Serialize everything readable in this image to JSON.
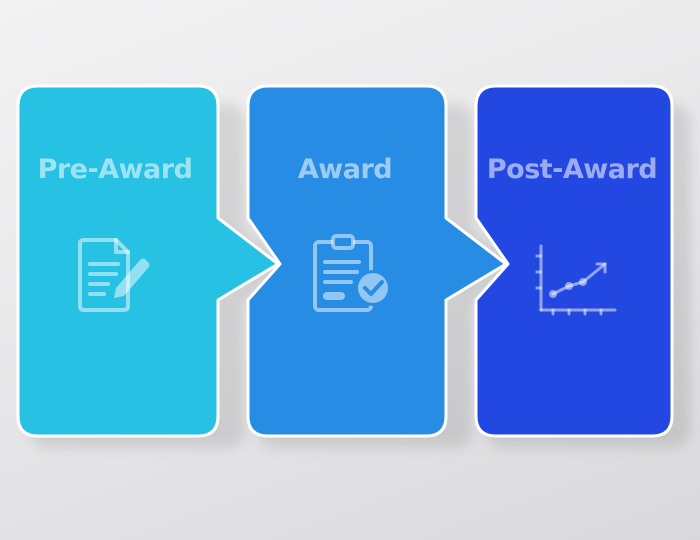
{
  "stages": [
    {
      "label": "Pre-Award",
      "color": "#27c1e4",
      "icon": "document-edit-icon"
    },
    {
      "label": "Award",
      "color": "#278de4",
      "icon": "clipboard-check-icon"
    },
    {
      "label": "Post-Award",
      "color": "#2348e2",
      "icon": "line-chart-icon"
    }
  ],
  "colors": {
    "background": "#e9e9eb",
    "border": "#ffffff",
    "icon": "#ffffff"
  }
}
